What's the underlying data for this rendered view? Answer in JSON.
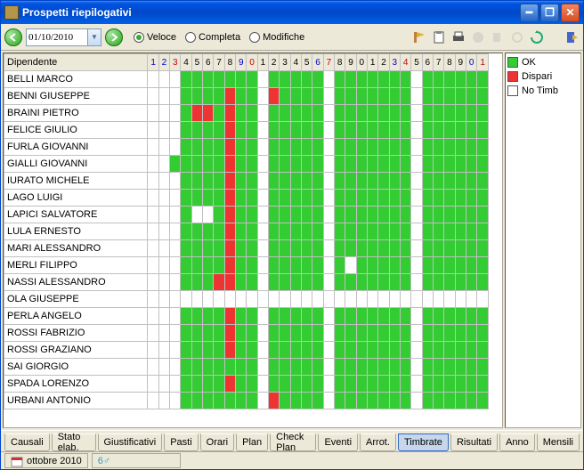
{
  "window": {
    "title": "Prospetti riepilogativi"
  },
  "toolbar": {
    "date": "01/10/2010",
    "radios": {
      "veloce": "Veloce",
      "completa": "Completa",
      "modifiche": "Modifiche"
    }
  },
  "grid_header_label": "Dipendente",
  "days": [
    {
      "n": "1",
      "c": "b"
    },
    {
      "n": "2",
      "c": "b"
    },
    {
      "n": "3",
      "c": "r"
    },
    {
      "n": "4",
      "c": "k"
    },
    {
      "n": "5",
      "c": "k"
    },
    {
      "n": "6",
      "c": "k"
    },
    {
      "n": "7",
      "c": "k"
    },
    {
      "n": "8",
      "c": "k"
    },
    {
      "n": "9",
      "c": "b"
    },
    {
      "n": "0",
      "c": "r"
    },
    {
      "n": "1",
      "c": "k"
    },
    {
      "n": "2",
      "c": "k"
    },
    {
      "n": "3",
      "c": "k"
    },
    {
      "n": "4",
      "c": "k"
    },
    {
      "n": "5",
      "c": "k"
    },
    {
      "n": "6",
      "c": "b"
    },
    {
      "n": "7",
      "c": "r"
    },
    {
      "n": "8",
      "c": "k"
    },
    {
      "n": "9",
      "c": "k"
    },
    {
      "n": "0",
      "c": "k"
    },
    {
      "n": "1",
      "c": "k"
    },
    {
      "n": "2",
      "c": "k"
    },
    {
      "n": "3",
      "c": "b"
    },
    {
      "n": "4",
      "c": "r"
    },
    {
      "n": "5",
      "c": "k"
    },
    {
      "n": "6",
      "c": "k"
    },
    {
      "n": "7",
      "c": "k"
    },
    {
      "n": "8",
      "c": "k"
    },
    {
      "n": "9",
      "c": "k"
    },
    {
      "n": "0",
      "c": "b"
    },
    {
      "n": "1",
      "c": "r"
    }
  ],
  "rows": [
    {
      "name": "BELLI MARCO",
      "cells": "...ggggggg.ggggg.ggggggg.ggggggg."
    },
    {
      "name": "BENNI GIUSEPPE",
      "cells": "...ggggrgg.rgggg.ggggggg.ggggggg."
    },
    {
      "name": "BRAINI PIETRO",
      "cells": "...grrgrgg.ggggg.ggggggg.ggggggg."
    },
    {
      "name": "FELICE GIULIO",
      "cells": "...ggggrgg.ggggg.ggggggg.ggggggg."
    },
    {
      "name": "FURLA GIOVANNI",
      "cells": "...ggggrgg.ggggg.ggggggg.ggggggg."
    },
    {
      "name": "GIALLI GIOVANNI",
      "cells": "..gggggrgg.ggggg.ggggggg.ggggggg."
    },
    {
      "name": "IURATO MICHELE",
      "cells": "...ggggrgg.ggggg.ggggggg.ggggggg."
    },
    {
      "name": "LAGO LUIGI",
      "cells": "...ggggrgg.ggggg.ggggggg.ggggggg."
    },
    {
      "name": "LAPICI SALVATORE",
      "cells": "...g..grgg.ggggg.ggggggg.ggggggg."
    },
    {
      "name": "LULA ERNESTO",
      "cells": "...ggggrgg.ggggg.ggggggg.ggggggg."
    },
    {
      "name": "MARI ALESSANDRO",
      "cells": "...ggggrgg.ggggg.ggggggg.ggggggg."
    },
    {
      "name": "MERLI FILIPPO",
      "cells": "...ggggrgg.ggggg.g.ggggg.ggggggg."
    },
    {
      "name": "NASSI ALESSANDRO",
      "cells": "...gggrrgg.ggggg.ggggggg.ggggggg."
    },
    {
      "name": "OLA GIUSEPPE",
      "cells": "................................."
    },
    {
      "name": "PERLA ANGELO",
      "cells": "...ggggrgg.ggggg.ggggggg.ggggggg."
    },
    {
      "name": "ROSSI FABRIZIO",
      "cells": "...ggggrgg.ggggg.ggggggg.ggggggg."
    },
    {
      "name": "ROSSI GRAZIANO",
      "cells": "...ggggrgg.ggggg.ggggggg.ggggggg."
    },
    {
      "name": "SAI GIORGIO",
      "cells": "...ggggggg.ggggg.ggggggg.ggggggg."
    },
    {
      "name": "SPADA LORENZO",
      "cells": "...ggggrgg.ggggg.ggggggg.ggggggg."
    },
    {
      "name": "URBANI ANTONIO",
      "cells": "...ggggggg.rgggg.ggggggg.ggggggg."
    }
  ],
  "legend": {
    "ok": "OK",
    "dispari": "Dispari",
    "notimb": "No Timb"
  },
  "tabs": [
    "Causali",
    "Stato elab.",
    "Giustificativi",
    "Pasti",
    "Orari",
    "Plan",
    "Check Plan",
    "Eventi",
    "Arrot.",
    "Timbrate",
    "Risultati",
    "Anno",
    "Mensili"
  ],
  "active_tab": 9,
  "status": {
    "month": "ottobre 2010"
  }
}
